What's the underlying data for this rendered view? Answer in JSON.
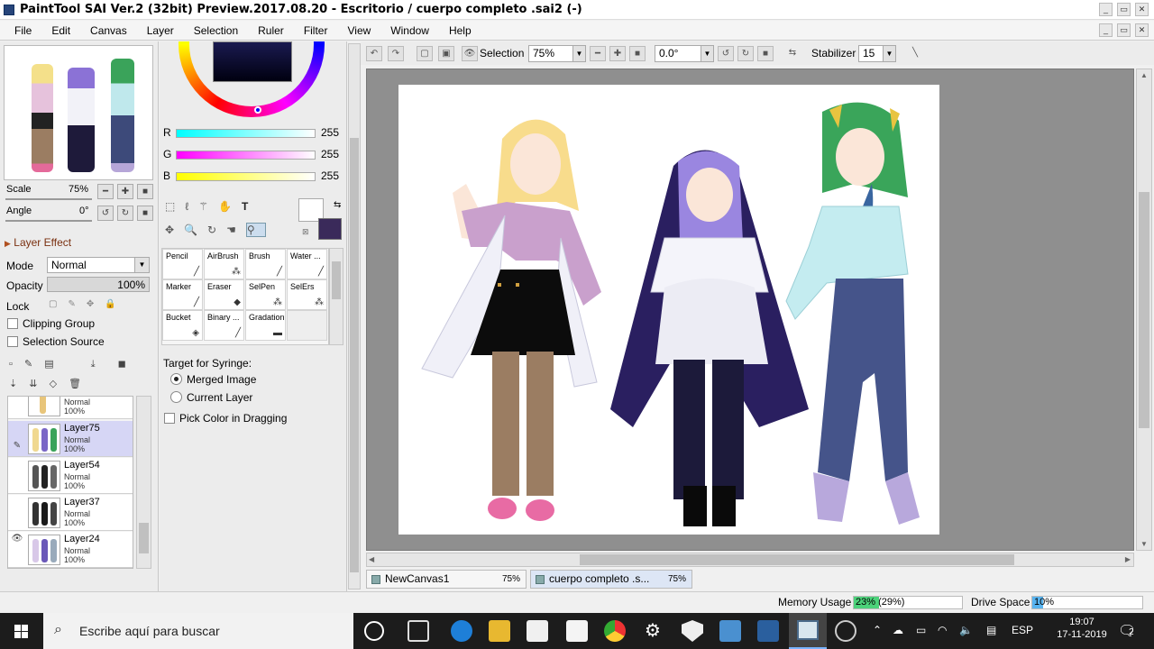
{
  "window": {
    "title": "PaintTool SAI Ver.2 (32bit) Preview.2017.08.20 - Escritorio / cuerpo completo .sai2 (-)",
    "controls": [
      "_",
      "▭",
      "✕"
    ]
  },
  "menu": [
    "File",
    "Edit",
    "Canvas",
    "Layer",
    "Selection",
    "Ruler",
    "Filter",
    "View",
    "Window",
    "Help"
  ],
  "navigator": {
    "scale_label": "Scale",
    "scale_value": "75%",
    "angle_label": "Angle",
    "angle_value": "0°"
  },
  "layer_effect": {
    "title": "Layer Effect",
    "mode_label": "Mode",
    "mode_value": "Normal",
    "opacity_label": "Opacity",
    "opacity_value": "100%",
    "lock_label": "Lock",
    "clipping_group": "Clipping Group",
    "selection_source": "Selection Source"
  },
  "layers": [
    {
      "name": "",
      "mode": "Normal",
      "opacity": "100%",
      "selected": false,
      "visible": false
    },
    {
      "name": "Layer75",
      "mode": "Normal",
      "opacity": "100%",
      "selected": true,
      "visible": false
    },
    {
      "name": "Layer54",
      "mode": "Normal",
      "opacity": "100%",
      "selected": false,
      "visible": false
    },
    {
      "name": "Layer37",
      "mode": "Normal",
      "opacity": "100%",
      "selected": false,
      "visible": false
    },
    {
      "name": "Layer24",
      "mode": "Normal",
      "opacity": "100%",
      "selected": false,
      "visible": true
    }
  ],
  "color": {
    "r_label": "R",
    "g_label": "G",
    "b_label": "B",
    "r_value": "255",
    "g_value": "255",
    "b_value": "255",
    "primary": "#ffffff",
    "secondary": "#3a2a5a"
  },
  "tools": [
    [
      "Pencil",
      "AirBrush",
      "Brush",
      "Water ..."
    ],
    [
      "Marker",
      "Eraser",
      "SelPen",
      "SelErs"
    ],
    [
      "Bucket",
      "Binary ...",
      "Gradation",
      ""
    ]
  ],
  "syringe": {
    "title": "Target for Syringe:",
    "merged": "Merged Image",
    "current": "Current Layer",
    "pick": "Pick Color in Dragging"
  },
  "toolbar": {
    "selection_label": "Selection",
    "zoom": "75%",
    "angle": "0.0°",
    "stabilizer_label": "Stabilizer",
    "stabilizer_value": "15"
  },
  "doc_tabs": [
    {
      "name": "NewCanvas1",
      "zoom": "75%",
      "active": false
    },
    {
      "name": "cuerpo completo .s...",
      "zoom": "75%",
      "active": true
    }
  ],
  "status": {
    "memory_label": "Memory Usage",
    "memory_value": "23% (29%)",
    "memory_fill": 0.23,
    "drive_label": "Drive Space",
    "drive_value": "10%",
    "drive_fill": 0.1
  },
  "taskbar": {
    "search_placeholder": "Escribe aquí para buscar",
    "language": "ESP",
    "time": "19:07",
    "date": "17-11-2019",
    "notifications": "2"
  }
}
